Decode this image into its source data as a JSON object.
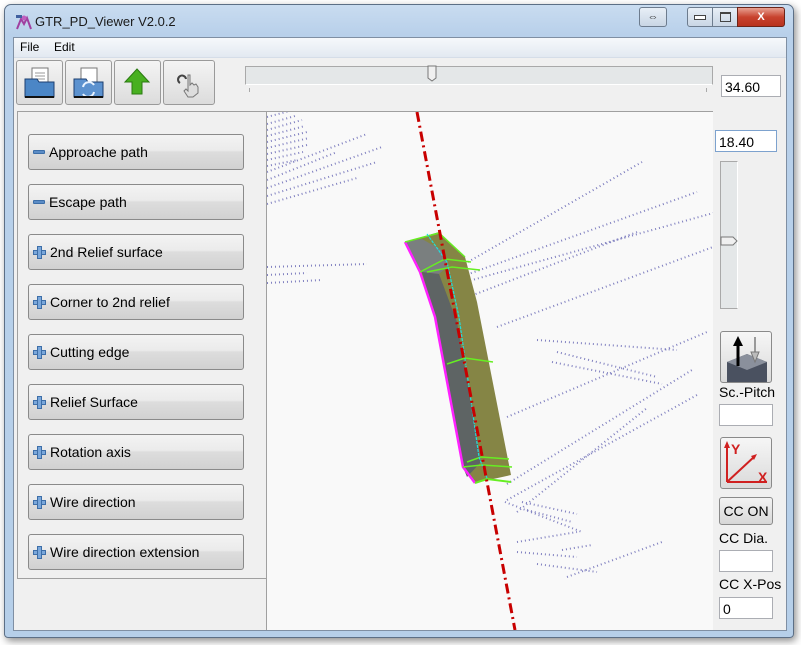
{
  "window": {
    "title": "GTR_PD_Viewer  V2.0.2",
    "controls": {
      "restore_glyph": "⇔",
      "minimize_glyph": "–",
      "maximize_glyph": "▢",
      "close_glyph": "X"
    }
  },
  "menu": {
    "items": [
      "File",
      "Edit"
    ]
  },
  "toolbar": {
    "buttons": [
      {
        "name": "open-file",
        "icon": "folder-document-icon"
      },
      {
        "name": "reload-file",
        "icon": "folder-refresh-icon"
      },
      {
        "name": "upload",
        "icon": "green-up-arrow-icon"
      },
      {
        "name": "pick",
        "icon": "hand-pointer-icon"
      }
    ],
    "horizontal_slider": {
      "value_fraction": 0.4
    },
    "horizontal_value": "34.60"
  },
  "sidebar": {
    "items": [
      {
        "label": "Approache path",
        "state": "collapsed-minus"
      },
      {
        "label": "Escape path",
        "state": "collapsed-minus"
      },
      {
        "label": "2nd Relief surface",
        "state": "plus"
      },
      {
        "label": "Corner to 2nd relief",
        "state": "plus"
      },
      {
        "label": "Cutting edge",
        "state": "plus"
      },
      {
        "label": "Relief Surface",
        "state": "plus"
      },
      {
        "label": "Rotation axis",
        "state": "plus"
      },
      {
        "label": "Wire direction",
        "state": "plus"
      },
      {
        "label": "Wire direction extension",
        "state": "plus"
      }
    ]
  },
  "viewport": {
    "colors": {
      "axis_line": "#c80000",
      "relief_face": "#858545",
      "side_face": "#5e6464",
      "top_face": "#7a7f7f",
      "edge_green": "#66ee22",
      "edge_magenta": "#ff22ff",
      "edge_cyan": "#22dddd",
      "wire_dots": "#8080c0"
    }
  },
  "right_panel": {
    "vertical_value": "18.40",
    "vertical_slider": {
      "value_fraction": 0.55
    },
    "pitch_label": "Sc.-Pitch",
    "pitch_value": "",
    "axes_icon": {
      "y_label": "Y",
      "x_label": "X"
    },
    "cc_button": "CC ON",
    "cc_dia_label": "CC Dia.",
    "cc_dia_value": "",
    "cc_xpos_label": "CC X-Pos",
    "cc_xpos_value": "0"
  }
}
